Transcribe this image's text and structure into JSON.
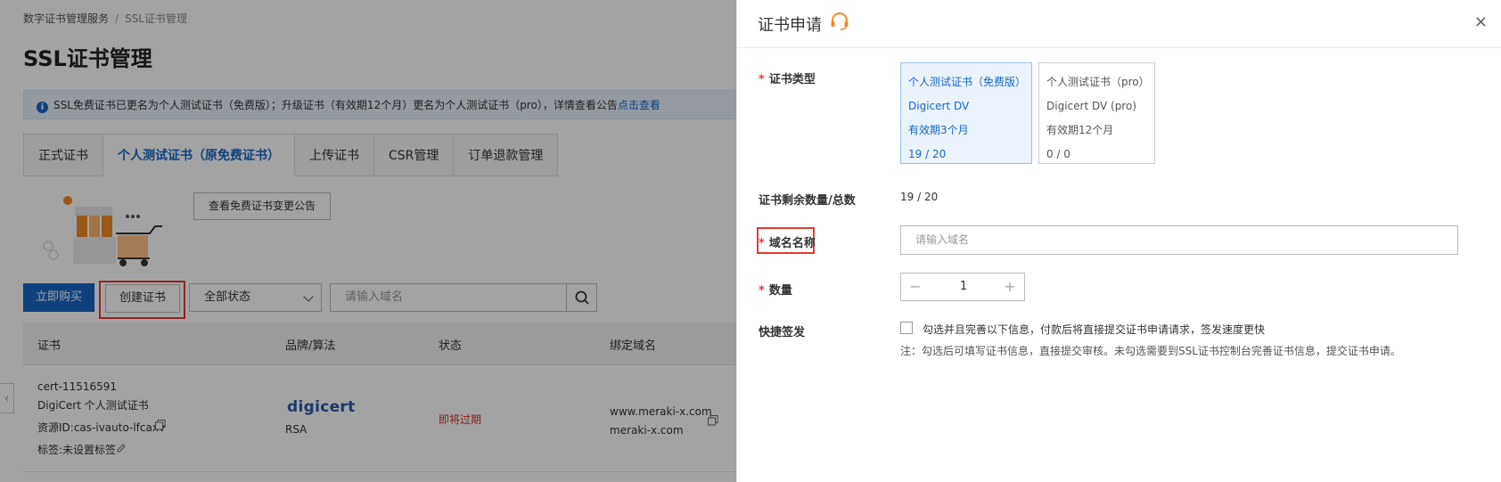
{
  "breadcrumb": {
    "root": "数字证书管理服务",
    "separator": "/",
    "current": "SSL证书管理"
  },
  "page_title": "SSL证书管理",
  "notice": {
    "text": "SSL免费证书已更名为个人测试证书（免费版）；升级证书（有效期12个月）更名为个人测试证书（pro），详情查看公告",
    "link": "点击查看",
    "icon": "i"
  },
  "tabs": [
    {
      "label": "正式证书"
    },
    {
      "label": "个人测试证书（原免费证书）"
    },
    {
      "label": "上传证书"
    },
    {
      "label": "CSR管理"
    },
    {
      "label": "订单退款管理"
    }
  ],
  "view_notice_button": "查看免费证书变更公告",
  "toolbar": {
    "buy_label": "立即购买",
    "create_label": "创建证书",
    "status_select": "全部状态",
    "search_placeholder": "请输入域名"
  },
  "table": {
    "columns": [
      "证书",
      "品牌/算法",
      "状态",
      "绑定域名"
    ],
    "row": {
      "cert_name": "cert-11516591",
      "cert_type": "DigiCert 个人测试证书",
      "resource_id": "资源ID:cas-ivauto-lfcaxv",
      "tags": "标签:未设置标签",
      "brand": "digicert",
      "algo": "RSA",
      "status": "即将过期",
      "domain1": "www.meraki-x.com",
      "domain2": "meraki-x.com"
    }
  },
  "side_arrow": "‹",
  "drawer": {
    "title": "证书申请",
    "close": "×",
    "cert_type_label": "证书类型",
    "required_mark": "*",
    "cards": [
      {
        "name": "个人测试证书（免费版）",
        "brand": "Digicert DV",
        "validity": "有效期3个月",
        "count": "19 / 20"
      },
      {
        "name": "个人测试证书（pro）",
        "brand": "Digicert DV (pro)",
        "validity": "有效期12个月",
        "count": "0 / 0"
      }
    ],
    "remaining_label": "证书剩余数量/总数",
    "remaining_value": "19 / 20",
    "domain_label": "域名名称",
    "domain_placeholder": "请输入域名",
    "quantity_label": "数量",
    "quantity_minus": "−",
    "quantity_value": "1",
    "quantity_plus": "+",
    "quick_label": "快捷签发",
    "quick_checkbox_text": "勾选并且完善以下信息，付款后将直接提交证书申请请求，签发速度更快",
    "quick_note": "注：勾选后可填写证书信息，直接提交审核。未勾选需要到SSL证书控制台完善证书信息，提交证书申请。"
  },
  "colors": {
    "accent": "#1768c7",
    "danger": "#e53935",
    "support_icon": "#f08a24"
  }
}
